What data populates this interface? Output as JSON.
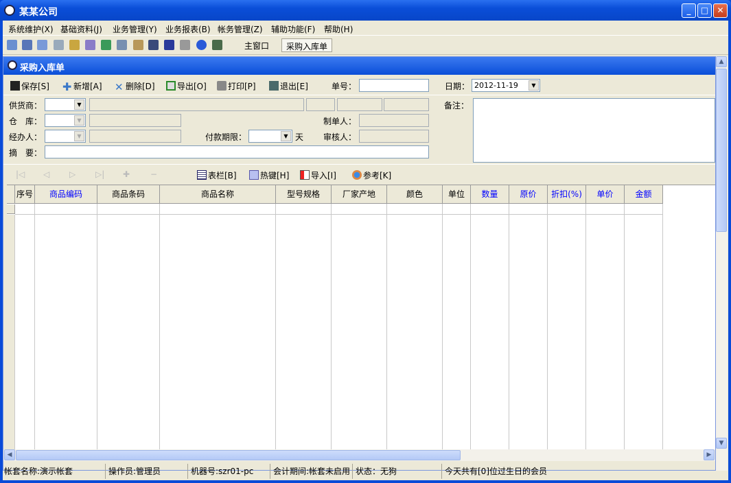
{
  "window": {
    "title": "某某公司"
  },
  "menu": [
    "系统维护(X)",
    "基础资料(J)",
    "业务管理(Y)",
    "业务报表(B)",
    "帐务管理(Z)",
    "辅助功能(F)",
    "帮助(H)"
  ],
  "toolbar": {
    "tabs": [
      "主窗口",
      "采购入库单"
    ]
  },
  "doc": {
    "title": "采购入库单",
    "actions": [
      "保存[S]",
      "新增[A]",
      "删除[D]",
      "导出[O]",
      "打印[P]",
      "退出[E]"
    ],
    "order_no_label": "单号：",
    "order_no": "",
    "date_label": "日期：",
    "date": "2012-11-19",
    "supplier_label": "供货商：",
    "warehouse_label": "仓　库：",
    "handler_label": "经办人：",
    "summary_label": "摘　要：",
    "payment_label": "付款期限：",
    "payment_unit": "天",
    "maker_label": "制单人：",
    "auditor_label": "审核人：",
    "remark_label": "备注：",
    "nav_buttons": [
      "表栏[B]",
      "热键[H]",
      "导入[I]",
      "参考[K]"
    ],
    "columns": [
      "序号",
      "商品编码",
      "商品条码",
      "商品名称",
      "型号规格",
      "厂家产地",
      "颜色",
      "单位",
      "数量",
      "原价",
      "折扣(%)",
      "单价",
      "金额"
    ]
  },
  "status": [
    "帐套名称:演示帐套",
    "操作员:管理员",
    "机器号:szr01-pc",
    "会计期间:帐套未启用",
    "状态：无狗",
    "今天共有[0]位过生日的会员"
  ],
  "colors": {
    "title_blue": "#0a4ed8",
    "header_blue_text": "#0000ff"
  }
}
